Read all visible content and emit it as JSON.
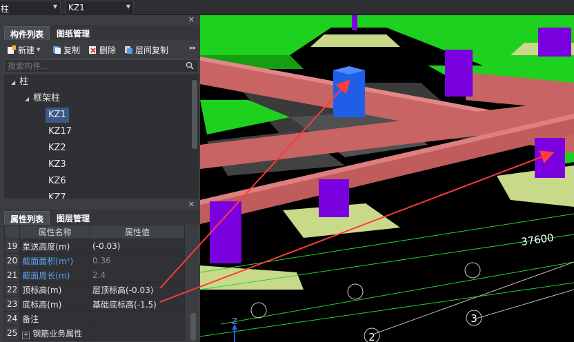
{
  "topbar": {
    "category_value": "柱",
    "component_value": "KZ1"
  },
  "component_panel": {
    "tabs": [
      "构件列表",
      "图纸管理"
    ],
    "toolbar": {
      "new_label": "新建",
      "copy_label": "复制",
      "delete_label": "删除",
      "floor_copy_label": "层间复制"
    },
    "search_placeholder": "搜索构件...",
    "tree": {
      "root": "柱",
      "group": "框架柱",
      "items": [
        "KZ1",
        "KZ17",
        "KZ2",
        "KZ3",
        "KZ6",
        "KZ7"
      ],
      "selected": "KZ1"
    }
  },
  "property_panel": {
    "tabs": [
      "属性列表",
      "图层管理"
    ],
    "headers": {
      "name": "属性名称",
      "value": "属性值"
    },
    "rows": [
      {
        "num": "19",
        "name": "泵送高度(m)",
        "value": "(-0.03)"
      },
      {
        "num": "20",
        "name": "截面面积(m²)",
        "value": "0.36"
      },
      {
        "num": "21",
        "name": "截面周长(m)",
        "value": "2.4"
      },
      {
        "num": "22",
        "name": "顶标高(m)",
        "value": "层顶标高(-0.03)"
      },
      {
        "num": "23",
        "name": "底标高(m)",
        "value": "基础底标高(-1.5)"
      },
      {
        "num": "24",
        "name": "备注",
        "value": ""
      },
      {
        "num": "25",
        "name": "钢筋业务属性",
        "value": ""
      }
    ]
  },
  "viewport": {
    "dimension_label": "37600",
    "axis_numbers": [
      "3",
      "2"
    ],
    "axis_z_label": "Z",
    "colors": {
      "slab": "#1fd11f",
      "beam": "#d46f6f",
      "column": "#7a00e0",
      "selected_column": "#1f5fe8",
      "footing": "#c9d98a",
      "annotation_arrow": "#ff3b3b"
    }
  }
}
